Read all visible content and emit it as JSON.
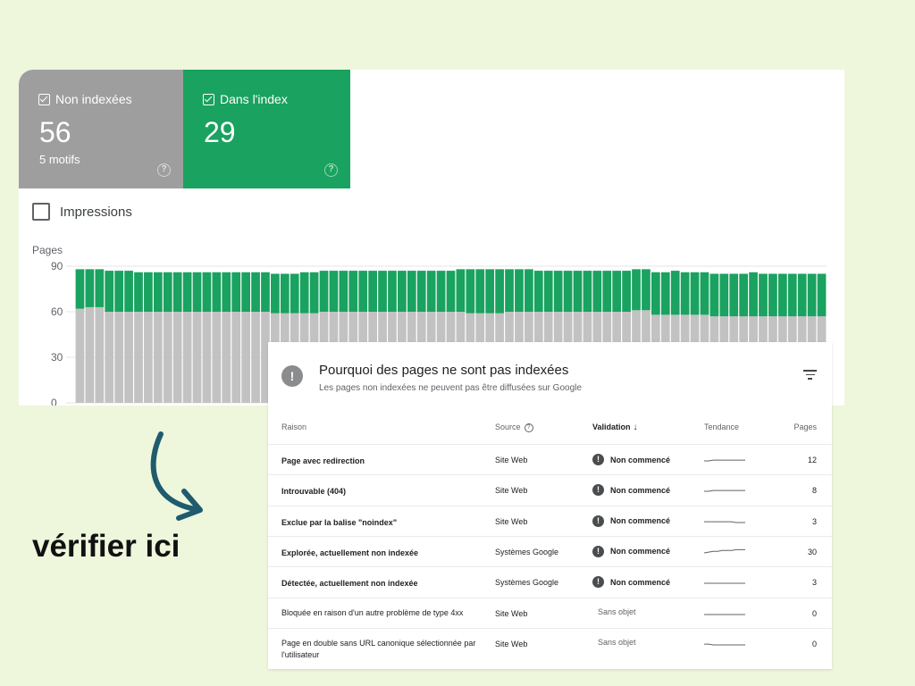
{
  "tiles": {
    "not_indexed": {
      "label": "Non indexées",
      "count": "56",
      "sub": "5 motifs",
      "help": "?"
    },
    "indexed": {
      "label": "Dans l'index",
      "count": "29",
      "help": "?"
    }
  },
  "impressions": {
    "label": "Impressions"
  },
  "chart_data": {
    "type": "bar",
    "ylabel": "Pages",
    "ylim": [
      0,
      90
    ],
    "yticks": [
      0,
      30,
      60,
      90
    ],
    "grid": true,
    "stacked": true,
    "series": [
      {
        "name": "Non indexées",
        "color": "#c2c2c2",
        "values": [
          62,
          63,
          63,
          60,
          60,
          60,
          60,
          60,
          60,
          60,
          60,
          60,
          60,
          60,
          60,
          60,
          60,
          60,
          60,
          60,
          59,
          59,
          59,
          59,
          59,
          60,
          60,
          60,
          60,
          60,
          60,
          60,
          60,
          60,
          60,
          60,
          60,
          60,
          60,
          60,
          59,
          59,
          59,
          59,
          60,
          60,
          60,
          60,
          60,
          60,
          60,
          60,
          60,
          60,
          60,
          60,
          60,
          61,
          61,
          58,
          58,
          58,
          58,
          58,
          58,
          57,
          57,
          57,
          57,
          57,
          57,
          57,
          57,
          57,
          57,
          57,
          57
        ]
      },
      {
        "name": "Dans l'index",
        "color": "#1aa260",
        "values": [
          26,
          25,
          25,
          27,
          27,
          27,
          26,
          26,
          26,
          26,
          26,
          26,
          26,
          26,
          26,
          26,
          26,
          26,
          26,
          26,
          26,
          26,
          26,
          27,
          27,
          27,
          27,
          27,
          27,
          27,
          27,
          27,
          27,
          27,
          27,
          27,
          27,
          27,
          27,
          28,
          29,
          29,
          29,
          29,
          28,
          28,
          28,
          27,
          27,
          27,
          27,
          27,
          27,
          27,
          27,
          27,
          27,
          27,
          27,
          28,
          28,
          29,
          28,
          28,
          28,
          28,
          28,
          28,
          28,
          29,
          28,
          28,
          28,
          28,
          28,
          28,
          28
        ]
      }
    ],
    "colors": {
      "gridline": "#e6e6e6",
      "axis": "#5f6368"
    }
  },
  "panel": {
    "icon": "info-icon",
    "title": "Pourquoi des pages ne sont pas indexées",
    "subtitle": "Les pages non indexées ne peuvent pas être diffusées sur Google",
    "headers": {
      "reason": "Raison",
      "source": "Source",
      "validation": "Validation",
      "trend": "Tendance",
      "pages": "Pages"
    },
    "rows": [
      {
        "reason": "Page avec redirection",
        "source": "Site Web",
        "validation": "Non commencé",
        "pages": "12",
        "trend": [
          2,
          2,
          3,
          3,
          3,
          3,
          3,
          3,
          3,
          3
        ]
      },
      {
        "reason": "Introuvable (404)",
        "source": "Site Web",
        "validation": "Non commencé",
        "pages": "8",
        "trend": [
          2,
          2,
          3,
          3,
          3,
          3,
          3,
          3,
          3,
          3
        ]
      },
      {
        "reason": "Exclue par la balise \"noindex\"",
        "source": "Site Web",
        "validation": "Non commencé",
        "pages": "3",
        "trend": [
          3,
          3,
          3,
          3,
          3,
          3,
          3,
          2,
          2,
          2
        ]
      },
      {
        "reason": "Explorée, actuellement non indexée",
        "source": "Systèmes Google",
        "validation": "Non commencé",
        "pages": "30",
        "trend": [
          26,
          27,
          28,
          28,
          29,
          29,
          29,
          30,
          30,
          30
        ]
      },
      {
        "reason": "Détectée, actuellement non indexée",
        "source": "Systèmes Google",
        "validation": "Non commencé",
        "pages": "3",
        "trend": [
          3,
          3,
          3,
          3,
          3,
          3,
          3,
          3,
          3,
          3
        ]
      },
      {
        "reason": "Bloquée en raison d'un autre problème de type 4xx",
        "source": "Site Web",
        "validation": "Sans objet",
        "pages": "0",
        "trend": [
          0,
          0,
          0,
          0,
          0,
          0,
          0,
          0,
          0,
          0
        ]
      },
      {
        "reason": "Page en double sans URL canonique sélectionnée par l'utilisateur",
        "source": "Site Web",
        "validation": "Sans objet",
        "pages": "0",
        "trend": [
          1,
          1,
          0,
          0,
          0,
          0,
          0,
          0,
          0,
          0
        ]
      }
    ]
  },
  "annotation": {
    "text": "vérifier ici",
    "arrow_color": "#1f5b6e"
  }
}
